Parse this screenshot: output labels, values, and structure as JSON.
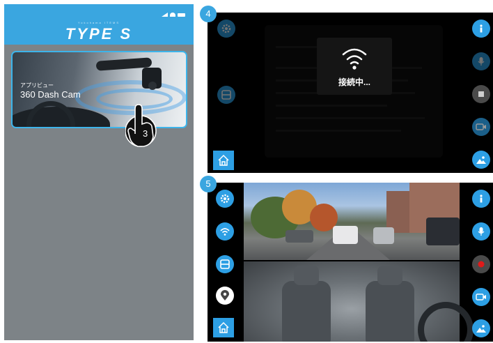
{
  "phone": {
    "brand_small": "Yokohama ITEMS",
    "brand": "TYPE S",
    "app_card": {
      "kana": "アプリビュー",
      "title": "360 Dash Cam"
    },
    "tap_step": "3"
  },
  "screen_a": {
    "step": "4",
    "status_text": "接続中..."
  },
  "screen_b": {
    "step": "5"
  },
  "colors": {
    "accent_blue": "#3aa6e0",
    "button_blue": "#2d9fe4",
    "record_red": "#e01a1a",
    "phone_gray": "#7d8387"
  },
  "icons": {
    "settings": "gear-icon",
    "wifi": "wifi-icon",
    "layout": "split-layout-icon",
    "location": "location-pin-icon",
    "home": "home-icon",
    "info": "info-icon",
    "mic": "microphone-icon",
    "stop": "stop-icon",
    "record": "record-icon",
    "video": "video-camera-icon",
    "gallery": "gallery-icon"
  }
}
